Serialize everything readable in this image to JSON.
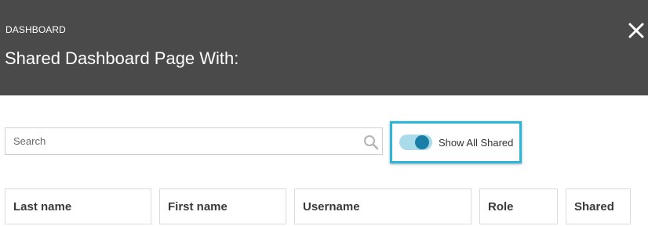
{
  "header": {
    "section_label": "DASHBOARD",
    "title": "Shared Dashboard Page With:",
    "close_icon": "close-icon",
    "background_color": "#4a4a4a"
  },
  "search": {
    "placeholder": "Search",
    "value": "",
    "icon": "search-icon"
  },
  "toggle": {
    "label": "Show All Shared",
    "state": "on",
    "highlight_color": "#29b6d8"
  },
  "table": {
    "columns": [
      {
        "label": "Last name"
      },
      {
        "label": "First name"
      },
      {
        "label": "Username"
      },
      {
        "label": "Role"
      },
      {
        "label": "Shared"
      }
    ]
  }
}
